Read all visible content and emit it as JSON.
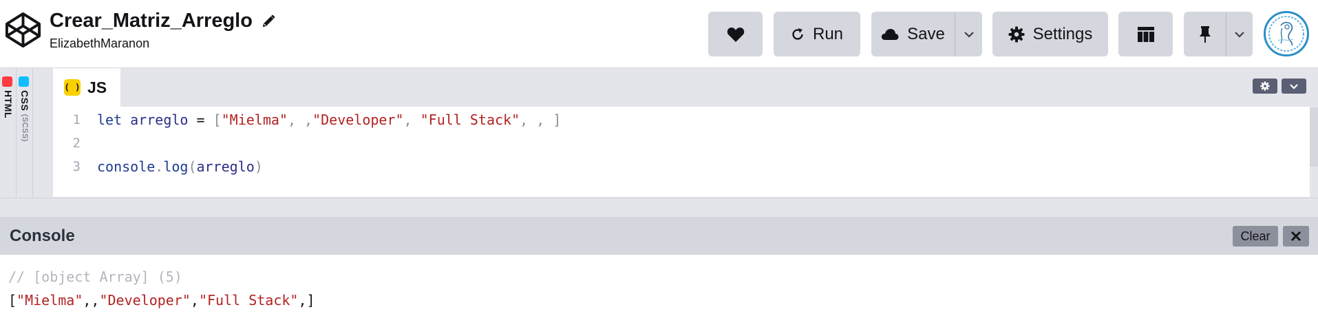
{
  "header": {
    "pen_title": "Crear_Matriz_Arreglo",
    "owner": "ElizabethMaranon",
    "buttons": {
      "run_label": "Run",
      "save_label": "Save",
      "settings_label": "Settings"
    }
  },
  "editor": {
    "side_tabs": [
      {
        "label": "HTML",
        "badge_color": "#ff3c41"
      },
      {
        "label": "CSS",
        "sublabel": "(SCSS)",
        "badge_color": "#0ebeff"
      }
    ],
    "active_tab": {
      "label": "JS",
      "badge_text": "( )",
      "badge_color": "#fcd000"
    },
    "lines": [
      {
        "number": "1",
        "tokens": [
          {
            "t": "let",
            "c": "tok-kw"
          },
          {
            "t": " ",
            "c": "tok-op"
          },
          {
            "t": "arreglo",
            "c": "tok-var"
          },
          {
            "t": " = ",
            "c": "tok-op"
          },
          {
            "t": "[",
            "c": "tok-punc"
          },
          {
            "t": "\"Mielma\"",
            "c": "tok-str"
          },
          {
            "t": ", ,",
            "c": "tok-punc"
          },
          {
            "t": "\"Developer\"",
            "c": "tok-str"
          },
          {
            "t": ", ",
            "c": "tok-punc"
          },
          {
            "t": "\"Full Stack\"",
            "c": "tok-str"
          },
          {
            "t": ", , ]",
            "c": "tok-punc"
          }
        ]
      },
      {
        "number": "2",
        "tokens": []
      },
      {
        "number": "3",
        "tokens": [
          {
            "t": "console",
            "c": "tok-id"
          },
          {
            "t": ".",
            "c": "tok-punc"
          },
          {
            "t": "log",
            "c": "tok-id"
          },
          {
            "t": "(",
            "c": "tok-punc"
          },
          {
            "t": "arreglo",
            "c": "tok-var"
          },
          {
            "t": ")",
            "c": "tok-punc"
          }
        ]
      }
    ]
  },
  "console": {
    "title": "Console",
    "clear_label": "Clear",
    "comment": "// [object Array] (5)",
    "output_tokens": [
      {
        "t": "[",
        "c": "out-punc"
      },
      {
        "t": "\"Mielma\"",
        "c": "out-str"
      },
      {
        "t": ",,",
        "c": "out-punc"
      },
      {
        "t": "\"Developer\"",
        "c": "out-str"
      },
      {
        "t": ",",
        "c": "out-punc"
      },
      {
        "t": "\"Full Stack\"",
        "c": "out-str"
      },
      {
        "t": ",]",
        "c": "out-punc"
      }
    ]
  },
  "colors": {
    "chrome_bg": "#d5d7de",
    "editor_bg": "#e4e5ea",
    "string": "#b22222",
    "keyword": "#1f3c8f"
  }
}
